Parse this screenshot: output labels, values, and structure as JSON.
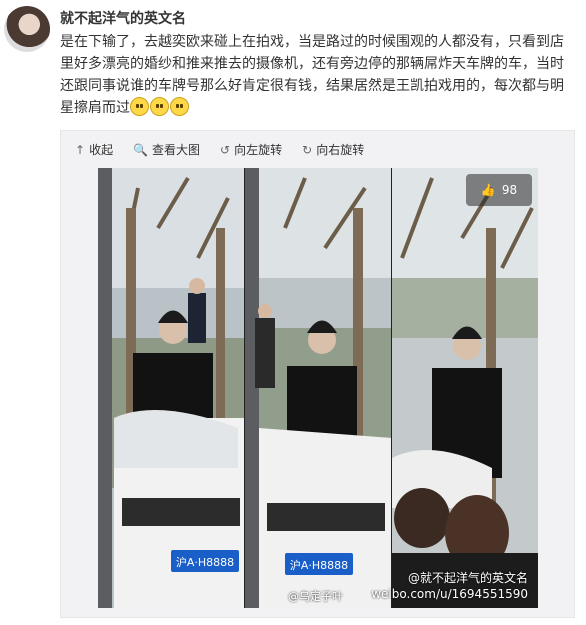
{
  "user": {
    "name": "就不起洋气的英文名"
  },
  "post": {
    "text": "是在下输了，去越奕欧来碰上在拍戏，当是路过的时候围观的人都没有，只看到店里好多漂亮的婚纱和推来推去的摄像机，还有旁边停的那辆屌炸天车牌的车，当时还跟同事说谁的车牌号那么好肯定很有钱，结果居然是王凯拍戏用的，每次都与明星擦肩而过",
    "emojis": [
      "smile",
      "smile",
      "smile"
    ]
  },
  "media": {
    "toolbar": {
      "collapse": "收起",
      "view_large": "查看大图",
      "rotate_left": "向左旋转",
      "rotate_right": "向右旋转"
    },
    "likes": "98",
    "plate": "沪A·H8888",
    "watermark_user": "@就不起洋气的英文名",
    "watermark_url": "weibo.com/u/1694551590",
    "credit": "@乌定子叶"
  }
}
